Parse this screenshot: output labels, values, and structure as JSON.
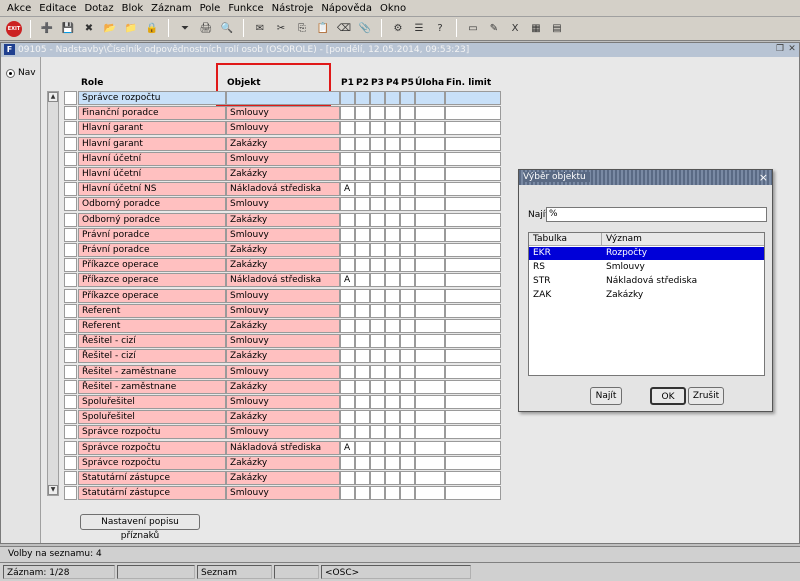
{
  "menubar": [
    "Akce",
    "Editace",
    "Dotaz",
    "Blok",
    "Záznam",
    "Pole",
    "Funkce",
    "Nástroje",
    "Nápověda",
    "Okno"
  ],
  "toolbar": {
    "exit_label": "EXIT",
    "icons": [
      "new-record-icon",
      "save-icon",
      "delete-record-icon",
      "folder-open-icon",
      "insert-icon",
      "lock-icon",
      "filter-icon",
      "print-icon",
      "find-icon",
      "mail-icon",
      "cut-icon",
      "copy-icon",
      "paste-icon",
      "clear-icon",
      "attach-icon",
      "tools-icon",
      "list-icon",
      "help-icon",
      "window-icon",
      "edit-icon",
      "excel-icon",
      "grid-icon",
      "calendar-icon"
    ]
  },
  "window": {
    "title": "09105 - Nadstavby\\Číselník odpovědnostních rolí osob (OSOROLE) - [pondělí, 12.05.2014, 09:53:23]",
    "icon_label": "F"
  },
  "left_panel": {
    "radio_label": "Nav"
  },
  "grid": {
    "headers": {
      "role": "Role",
      "objekt": "Objekt",
      "p1": "P1",
      "p2": "P2",
      "p3": "P3",
      "p4": "P4",
      "p5": "P5",
      "uloha": "Úloha",
      "fin_limit": "Fin. limit"
    },
    "rows": [
      {
        "role": "Správce rozpočtu",
        "objekt": "",
        "p1": ""
      },
      {
        "role": "Finanční poradce",
        "objekt": "Smlouvy",
        "p1": ""
      },
      {
        "role": "Hlavní garant",
        "objekt": "Smlouvy",
        "p1": ""
      },
      {
        "role": "Hlavní garant",
        "objekt": "Zakázky",
        "p1": ""
      },
      {
        "role": "Hlavní účetní",
        "objekt": "Smlouvy",
        "p1": ""
      },
      {
        "role": "Hlavní účetní",
        "objekt": "Zakázky",
        "p1": ""
      },
      {
        "role": "Hlavní účetní NS",
        "objekt": "Nákladová střediska",
        "p1": "A"
      },
      {
        "role": "Odborný poradce",
        "objekt": "Smlouvy",
        "p1": ""
      },
      {
        "role": "Odborný poradce",
        "objekt": "Zakázky",
        "p1": ""
      },
      {
        "role": "Právní poradce",
        "objekt": "Smlouvy",
        "p1": ""
      },
      {
        "role": "Právní poradce",
        "objekt": "Zakázky",
        "p1": ""
      },
      {
        "role": "Příkazce operace",
        "objekt": "Zakázky",
        "p1": ""
      },
      {
        "role": "Příkazce operace",
        "objekt": "Nákladová střediska",
        "p1": "A"
      },
      {
        "role": "Příkazce operace",
        "objekt": "Smlouvy",
        "p1": ""
      },
      {
        "role": "Referent",
        "objekt": "Smlouvy",
        "p1": ""
      },
      {
        "role": "Referent",
        "objekt": "Zakázky",
        "p1": ""
      },
      {
        "role": "Řešitel - cizí",
        "objekt": "Smlouvy",
        "p1": ""
      },
      {
        "role": "Řešitel - cizí",
        "objekt": "Zakázky",
        "p1": ""
      },
      {
        "role": "Řešitel - zaměstnane",
        "objekt": "Smlouvy",
        "p1": ""
      },
      {
        "role": "Řešitel - zaměstnane",
        "objekt": "Zakázky",
        "p1": ""
      },
      {
        "role": "Spoluřešitel",
        "objekt": "Smlouvy",
        "p1": ""
      },
      {
        "role": "Spoluřešitel",
        "objekt": "Zakázky",
        "p1": ""
      },
      {
        "role": "Správce rozpočtu",
        "objekt": "Smlouvy",
        "p1": ""
      },
      {
        "role": "Správce rozpočtu",
        "objekt": "Nákladová střediska",
        "p1": "A"
      },
      {
        "role": "Správce rozpočtu",
        "objekt": "Zakázky",
        "p1": ""
      },
      {
        "role": "Statutární zástupce",
        "objekt": "Zakázky",
        "p1": ""
      },
      {
        "role": "Statutární zástupce",
        "objekt": "Smlouvy",
        "p1": ""
      }
    ],
    "button_label": "Nastavení popisu příznaků"
  },
  "dialog": {
    "title": "Výběr objektu",
    "close": "×",
    "find_label": "Najít",
    "find_value": "%",
    "columns": [
      "Tabulka",
      "Význam"
    ],
    "items": [
      {
        "code": "EKR",
        "meaning": "Rozpočty",
        "selected": true
      },
      {
        "code": "RS",
        "meaning": "Smlouvy",
        "selected": false
      },
      {
        "code": "STR",
        "meaning": "Nákladová střediska",
        "selected": false
      },
      {
        "code": "ZAK",
        "meaning": "Zakázky",
        "selected": false
      }
    ],
    "buttons": {
      "find": "Najít",
      "ok": "OK",
      "cancel": "Zrušit"
    }
  },
  "status": {
    "line1": "Volby na seznamu: 4",
    "record": "Záznam: 1/28",
    "seg2": "",
    "list": "Seznam hodn...",
    "seg4": "",
    "osc": "<OSC>"
  }
}
